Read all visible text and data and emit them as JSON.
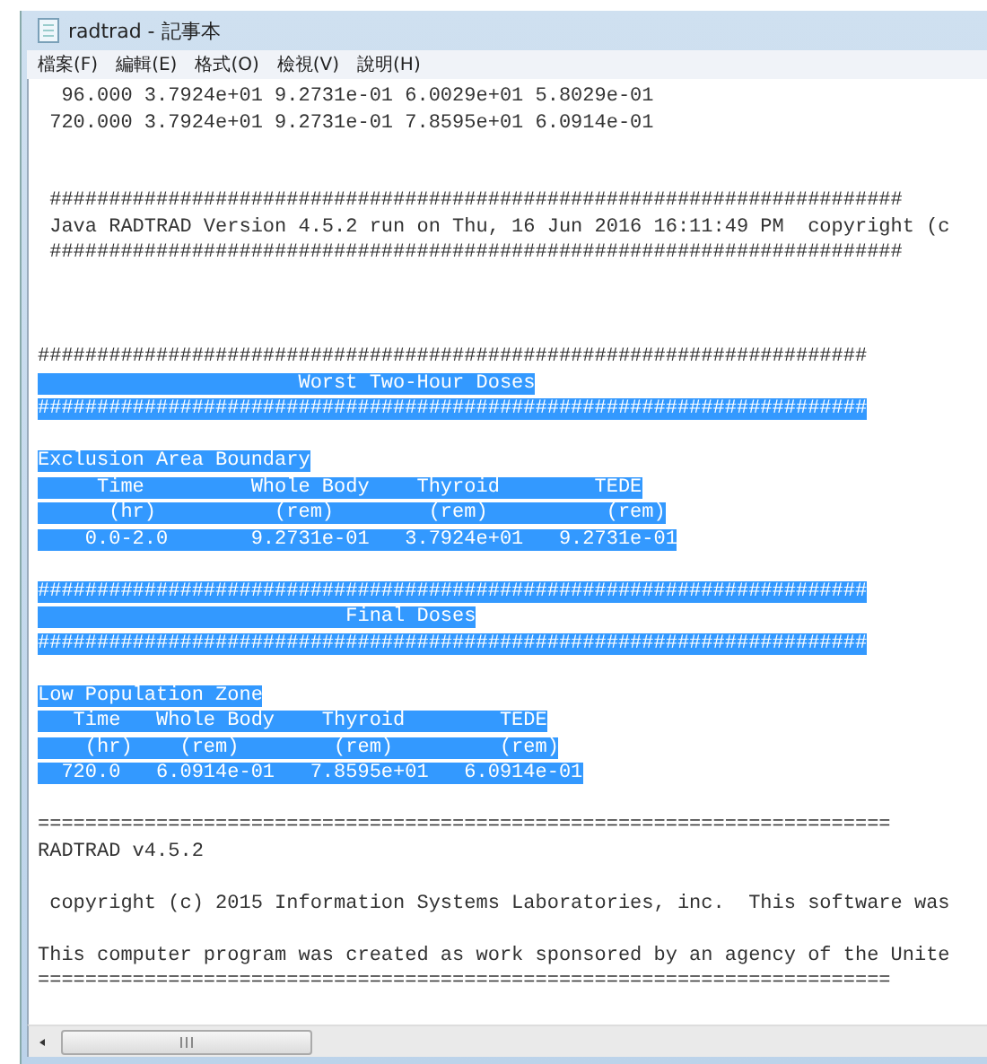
{
  "window": {
    "title": "radtrad - 記事本"
  },
  "menu": [
    "檔案(F)",
    "編輯(E)",
    "格式(O)",
    "檢視(V)",
    "說明(H)"
  ],
  "lines": [
    {
      "kind": "text",
      "text": "  96.000 3.7924e+01 9.2731e-01 6.0029e+01 5.8029e-01",
      "selected": false
    },
    {
      "kind": "text",
      "text": " 720.000 3.7924e+01 9.2731e-01 7.8595e+01 6.0914e-01",
      "selected": false
    },
    {
      "kind": "blank"
    },
    {
      "kind": "blank"
    },
    {
      "kind": "text",
      "text": " ########################################################################",
      "selected": false
    },
    {
      "kind": "text",
      "text": " Java RADTRAD Version 4.5.2 run on Thu, 16 Jun 2016 16:11:49 PM  copyright (c",
      "selected": false
    },
    {
      "kind": "text",
      "text": " ########################################################################",
      "selected": false
    },
    {
      "kind": "blank"
    },
    {
      "kind": "blank"
    },
    {
      "kind": "blank"
    },
    {
      "kind": "text",
      "text": "######################################################################",
      "selected": false
    },
    {
      "kind": "text",
      "text": "                      Worst Two-Hour Doses",
      "selected": true
    },
    {
      "kind": "text",
      "text": "######################################################################",
      "selected": true
    },
    {
      "kind": "blank"
    },
    {
      "kind": "text",
      "text": "Exclusion Area Boundary",
      "selected": true
    },
    {
      "kind": "text",
      "text": "     Time         Whole Body    Thyroid        TEDE",
      "selected": true
    },
    {
      "kind": "text",
      "text": "      (hr)          (rem)        (rem)          (rem)",
      "selected": true
    },
    {
      "kind": "text",
      "text": "    0.0-2.0       9.2731e-01   3.7924e+01   9.2731e-01",
      "selected": true
    },
    {
      "kind": "blank"
    },
    {
      "kind": "text",
      "text": "######################################################################",
      "selected": true
    },
    {
      "kind": "text",
      "text": "                          Final Doses",
      "selected": true
    },
    {
      "kind": "text",
      "text": "######################################################################",
      "selected": true
    },
    {
      "kind": "blank"
    },
    {
      "kind": "text",
      "text": "Low Population Zone",
      "selected": true
    },
    {
      "kind": "text",
      "text": "   Time   Whole Body    Thyroid        TEDE",
      "selected": true
    },
    {
      "kind": "text",
      "text": "    (hr)    (rem)        (rem)         (rem)",
      "selected": true
    },
    {
      "kind": "text",
      "text": "  720.0   6.0914e-01   7.8595e+01   6.0914e-01",
      "selected": true
    },
    {
      "kind": "blank"
    },
    {
      "kind": "text",
      "text": "========================================================================",
      "selected": false
    },
    {
      "kind": "text",
      "text": "RADTRAD v4.5.2",
      "selected": false
    },
    {
      "kind": "blank"
    },
    {
      "kind": "text",
      "text": " copyright (c) 2015 Information Systems Laboratories, inc.  This software was",
      "selected": false
    },
    {
      "kind": "blank"
    },
    {
      "kind": "text",
      "text": "This computer program was created as work sponsored by an agency of the Unite",
      "selected": false
    },
    {
      "kind": "text",
      "text": "========================================================================",
      "selected": false
    }
  ]
}
